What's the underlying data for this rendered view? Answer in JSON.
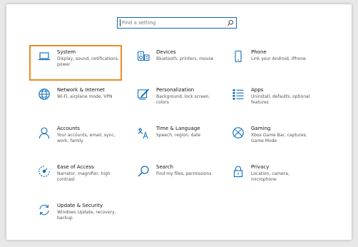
{
  "search": {
    "placeholder": "Find a setting",
    "icon": "search-icon"
  },
  "accent_color": "#0a6ab8",
  "selected_outline_color": "#f08a24",
  "tiles": [
    {
      "title": "System",
      "desc": "Display, sound, notifications, power",
      "icon": "laptop-icon"
    },
    {
      "title": "Devices",
      "desc": "Bluetooth, printers, mouse",
      "icon": "keyboard-speaker-icon"
    },
    {
      "title": "Phone",
      "desc": "Link your Android, iPhone",
      "icon": "phone-icon"
    },
    {
      "title": "Network & Internet",
      "desc": "Wi-Fi, airplane mode, VPN",
      "icon": "globe-icon"
    },
    {
      "title": "Personalization",
      "desc": "Background, lock screen, colors",
      "icon": "paint-pen-icon"
    },
    {
      "title": "Apps",
      "desc": "Uninstall, defaults, optional features",
      "icon": "apps-list-icon"
    },
    {
      "title": "Accounts",
      "desc": "Your accounts, email, sync, work, family",
      "icon": "person-icon"
    },
    {
      "title": "Time & Language",
      "desc": "Speech, region, date",
      "icon": "time-language-icon"
    },
    {
      "title": "Gaming",
      "desc": "Xbox Game Bar, captures, Game Mode",
      "icon": "xbox-icon"
    },
    {
      "title": "Ease of Access",
      "desc": "Narrator, magnifier, high contrast",
      "icon": "ease-of-access-icon"
    },
    {
      "title": "Search",
      "desc": "Find my files, permissions",
      "icon": "magnifier-icon"
    },
    {
      "title": "Privacy",
      "desc": "Location, camera, microphone",
      "icon": "lock-icon"
    },
    {
      "title": "Update & Security",
      "desc": "Windows Update, recovery, backup",
      "icon": "sync-icon"
    }
  ]
}
